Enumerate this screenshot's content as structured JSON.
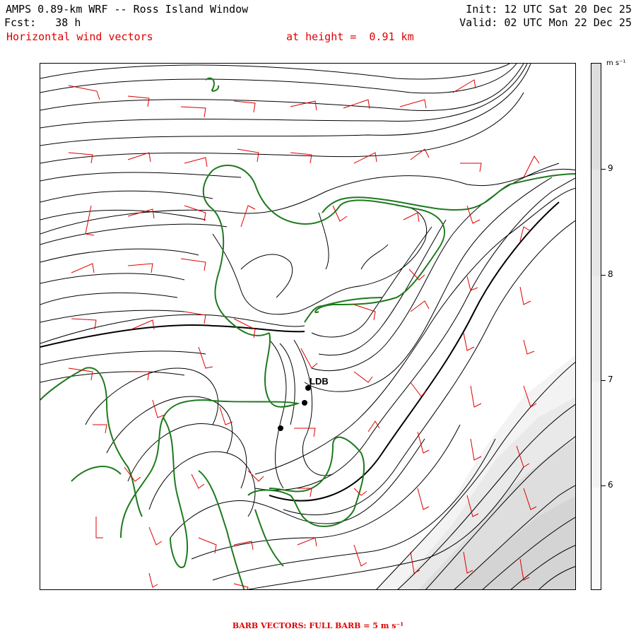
{
  "header": {
    "title": "AMPS 0.89-km WRF -- Ross Island Window",
    "forecast": "Fcst:   38 h",
    "init": "Init: 12 UTC Sat 20 Dec 25",
    "valid": "Valid: 02 UTC Mon 22 Dec 25",
    "product": "Horizontal wind vectors",
    "height_label": "at height =  0.91 km"
  },
  "colorbar": {
    "units": "m s⁻¹",
    "ticks": [
      "9",
      "8",
      "7",
      "6"
    ],
    "colors": [
      "#ffffff",
      "#f3f3f3",
      "#e9e9e9",
      "#dedede",
      "#d4d4d4"
    ]
  },
  "station": {
    "label": "LDB"
  },
  "footer": "BARB VECTORS:  FULL BARB = 5 m s⁻¹",
  "colors": {
    "coast": "#1e7a1e",
    "barb": "#e00000",
    "contour": "#000000"
  }
}
